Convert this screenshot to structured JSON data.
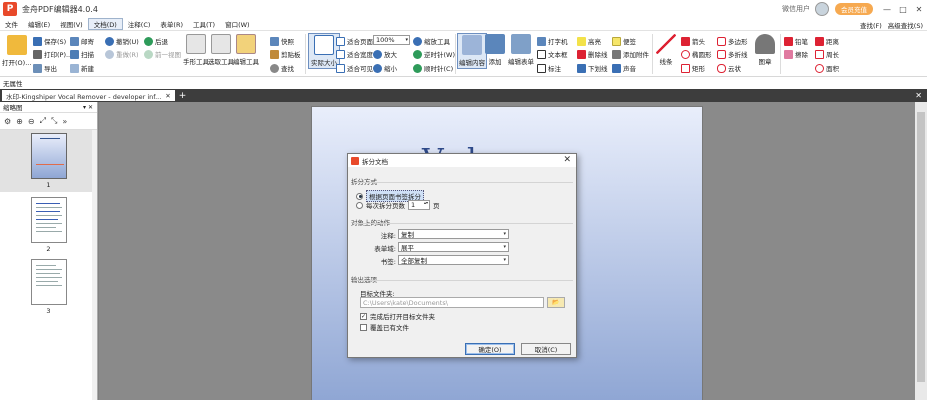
{
  "app": {
    "title": "金舟PDF编辑器4.0.4",
    "user": "微信用户",
    "vip_label": "会员充值",
    "win_controls": [
      "—",
      "□",
      "✕"
    ]
  },
  "menu": {
    "items": [
      "文件",
      "编辑(E)",
      "视图(V)",
      "文档(D)",
      "注释(C)",
      "表单(R)",
      "工具(T)",
      "窗口(W)"
    ],
    "active_index": 3,
    "right": [
      "查找(F)",
      "高级查找(S)"
    ]
  },
  "ribbon": {
    "open": "打开(O)...",
    "save": "保存(S)",
    "print": "打印(P)...",
    "export": "导出",
    "mail": "邮寄",
    "scan": "扫描",
    "new": "新建",
    "undo": "撤销(U)",
    "redo": "重做(R)",
    "back": "后退",
    "forward": "前一视图",
    "hand_tool": "手形工具",
    "select_text": "选取工具",
    "edit_tool": "编辑工具",
    "snapshot": "快照",
    "clipboard": "剪贴板",
    "find": "查找",
    "actual_size": "实际大小",
    "fit_page": "适合页面",
    "fit_width": "适合宽度",
    "fit_visible": "适合可见",
    "zoom_value": "100%",
    "zoom_in": "放大",
    "zoom_out": "缩小",
    "zoom_tool": "缩放工具",
    "rotate_cw": "逆时针(W)",
    "rotate_ccw": "顺时针(C)",
    "edit_content": "编辑内容",
    "add": "添加",
    "edit_form": "编辑表单",
    "typewriter": "打字机",
    "textbox": "文本框",
    "callout": "标注",
    "highlight": "高亮",
    "strikeout": "删除线",
    "underline": "下划线",
    "note": "便签",
    "attach": "添加附件",
    "sound": "声音",
    "line": "线条",
    "arrow": "箭头",
    "ellipse": "椭圆形",
    "rectangle": "矩形",
    "polygon": "多边形",
    "polyline": "多折线",
    "cloud": "云状",
    "stamp": "图章",
    "pencil": "铅笔",
    "eraser": "擦除",
    "distance": "距离",
    "perimeter": "周长",
    "area": "面积"
  },
  "status_line": "无属性",
  "doc_tab": {
    "label": "水印-Kingshiper Vocal Remover - developer inf...",
    "close": "✕",
    "add": "+",
    "strip_close": "✕"
  },
  "left_panel": {
    "title": "缩略图",
    "pin": "▾ ✕",
    "tools": [
      "⚙",
      "⊕",
      "⊖",
      "⤢",
      "⤡",
      "»"
    ],
    "thumbnails": [
      {
        "num": "1",
        "selected": true
      },
      {
        "num": "2",
        "selected": false
      },
      {
        "num": "3",
        "selected": false
      }
    ]
  },
  "document": {
    "page_title": "Vole   n"
  },
  "dialog": {
    "title": "拆分文档",
    "close": "✕",
    "section_mode": "拆分方式",
    "opt_bookmark": "根据页面书签拆分",
    "opt_pages": "每次拆分页数",
    "pages_value": "1",
    "pages_unit": "页",
    "section_objects": "对象上的动作",
    "annot_label": "注释:",
    "annot_value": "复制",
    "form_label": "表单域:",
    "form_value": "展平",
    "bookmark_label": "书签:",
    "bookmark_value": "全部复制",
    "section_output": "输出选项",
    "target_label": "目标文件夹:",
    "target_path": "C:\\Users\\kate\\Documents\\",
    "browse": "📂",
    "open_after": "完成后打开目标文件夹",
    "open_after_checked": true,
    "overwrite": "覆盖已有文件",
    "overwrite_checked": false,
    "ok": "确定(O)",
    "cancel": "取消(C)"
  }
}
